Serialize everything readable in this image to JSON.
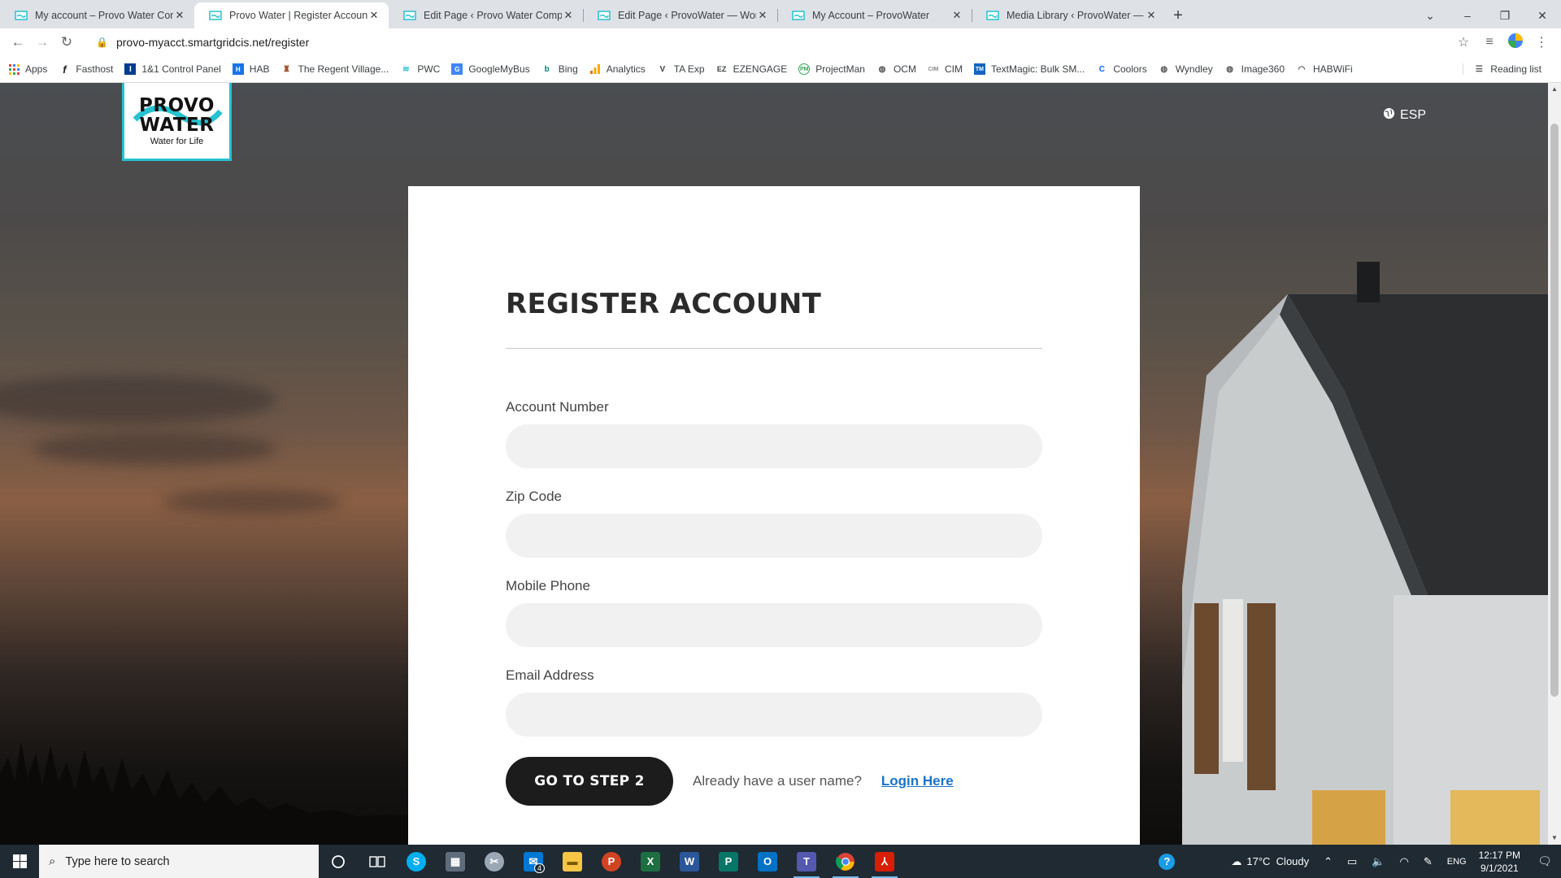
{
  "browser": {
    "tabs": [
      {
        "title": "My account – Provo Water Comp",
        "active": false
      },
      {
        "title": "Provo Water | Register Account",
        "active": true
      },
      {
        "title": "Edit Page ‹ Provo Water Compan",
        "active": false
      },
      {
        "title": "Edit Page ‹ ProvoWater — WordP",
        "active": false
      },
      {
        "title": "My Account – ProvoWater",
        "active": false
      },
      {
        "title": "Media Library ‹ ProvoWater — W",
        "active": false
      }
    ],
    "url": "provo-myacct.smartgridcis.net/register",
    "bookmarks": [
      {
        "label": "Apps",
        "icon": "apps-grid-icon",
        "color": "#ea4335"
      },
      {
        "label": "Fasthost",
        "icon": "facebook-f-icon",
        "color": "#222222"
      },
      {
        "label": "1&1 Control Panel",
        "icon": "ionos-icon",
        "color": "#003d8f"
      },
      {
        "label": "HAB",
        "icon": "hab-icon",
        "color": "#1a73e8"
      },
      {
        "label": "The Regent Village...",
        "icon": "regent-icon",
        "color": "#a0522d"
      },
      {
        "label": "PWC",
        "icon": "provo-icon",
        "color": "#27c2cf"
      },
      {
        "label": "GoogleMyBus",
        "icon": "gmb-icon",
        "color": "#4285f4"
      },
      {
        "label": "Bing",
        "icon": "bing-icon",
        "color": "#008373"
      },
      {
        "label": "Analytics",
        "icon": "analytics-icon",
        "color": "#f9ab00"
      },
      {
        "label": "TA Exp",
        "icon": "ta-icon",
        "color": "#222222"
      },
      {
        "label": "EZENGAGE",
        "icon": "ez-icon",
        "color": "#222222"
      },
      {
        "label": "ProjectMan",
        "icon": "projectman-icon",
        "color": "#34a853"
      },
      {
        "label": "OCM",
        "icon": "globe-icon",
        "color": "#555555"
      },
      {
        "label": "CIM",
        "icon": "cim-icon",
        "color": "#888888"
      },
      {
        "label": "TextMagic: Bulk SM...",
        "icon": "textmagic-icon",
        "color": "#1565c0"
      },
      {
        "label": "Coolors",
        "icon": "coolors-icon",
        "color": "#0066ff"
      },
      {
        "label": "Wyndley",
        "icon": "globe-icon",
        "color": "#555555"
      },
      {
        "label": "Image360",
        "icon": "globe-icon",
        "color": "#555555"
      },
      {
        "label": "HABWiFi",
        "icon": "wifi-icon",
        "color": "#555555"
      }
    ],
    "reading_list": "Reading list"
  },
  "page": {
    "logo": {
      "line1": "PROVO",
      "line2": "WATER",
      "tagline": "Water for Life"
    },
    "language_toggle": "ESP",
    "form": {
      "title": "REGISTER ACCOUNT",
      "fields": [
        {
          "label": "Account Number",
          "value": "",
          "placeholder": ""
        },
        {
          "label": "Zip Code",
          "value": "",
          "placeholder": ""
        },
        {
          "label": "Mobile Phone",
          "value": "",
          "placeholder": ""
        },
        {
          "label": "Email Address",
          "value": "",
          "placeholder": ""
        }
      ],
      "submit_label": "GO TO STEP 2",
      "login_prompt": "Already have a user name?",
      "login_link": "Login Here"
    }
  },
  "taskbar": {
    "search_placeholder": "Type here to search",
    "weather": "17°C  Cloudy",
    "language": "ENG",
    "time": "12:17 PM",
    "date": "9/1/2021",
    "mail_badge": "4"
  },
  "colors": {
    "accent_link": "#1a73c7",
    "button_dark": "#1c1c1c",
    "logo_border": "#27c2cf"
  }
}
